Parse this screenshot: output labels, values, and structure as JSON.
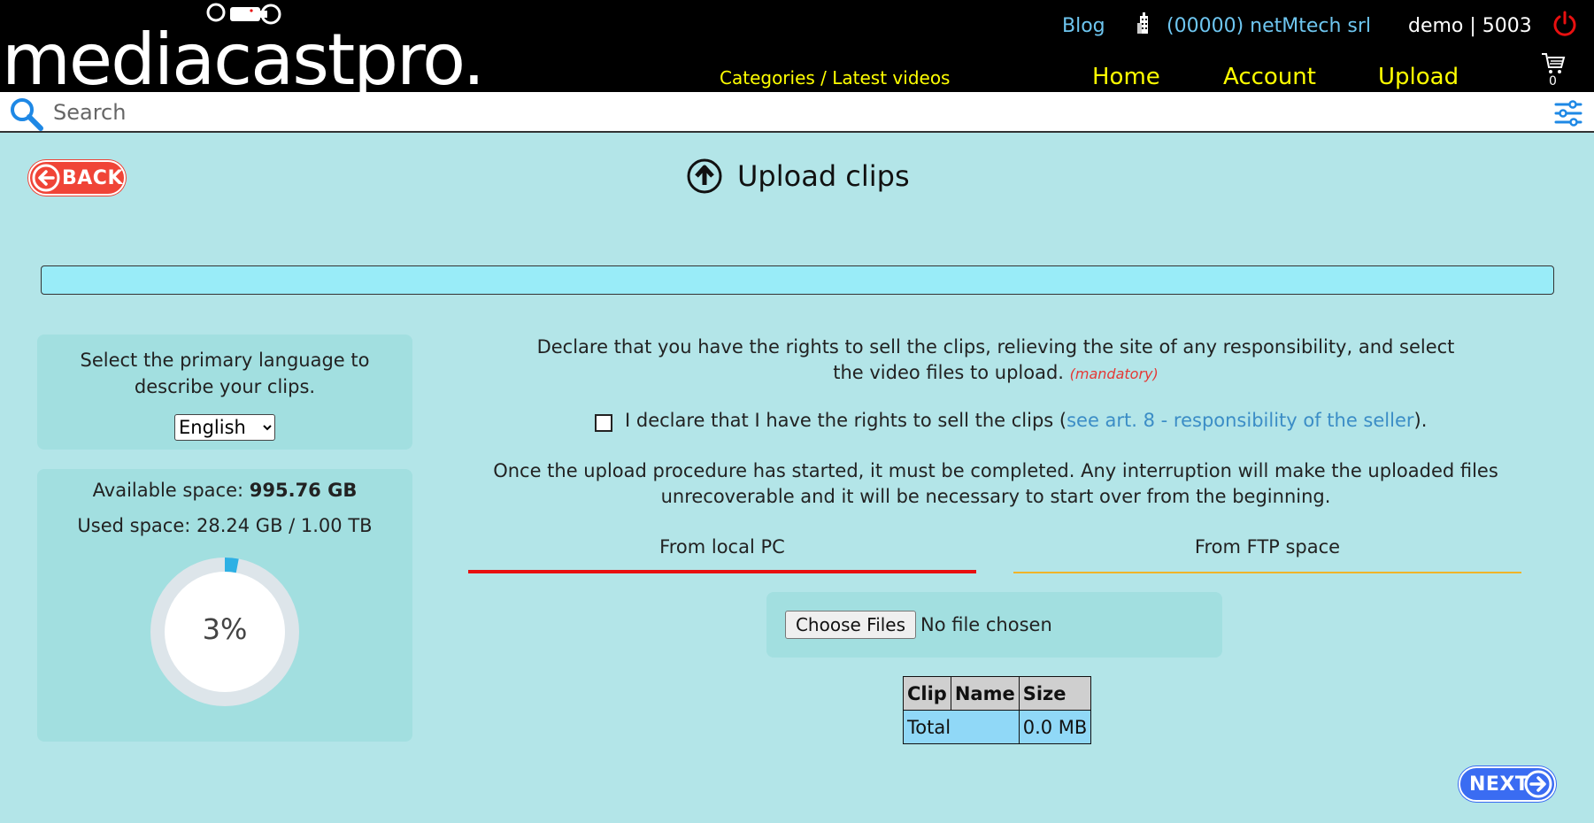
{
  "header": {
    "logo_text": "mediacastpro.",
    "blog_label": "Blog",
    "company_label": "(00000) netMtech srl",
    "user_info": "demo | 5003",
    "categories_label": "Categories / Latest videos",
    "nav": {
      "home": "Home",
      "account": "Account",
      "upload": "Upload"
    },
    "cart_count": "0",
    "colors": {
      "nav": "#ffff00",
      "link": "#6ec6f0",
      "power": "#e81010"
    }
  },
  "search": {
    "placeholder": "Search"
  },
  "page": {
    "back_label": "BACK",
    "title": "Upload clips",
    "next_label": "NEXT"
  },
  "language_panel": {
    "prompt": "Select the primary language to describe your clips.",
    "selected": "English"
  },
  "space_panel": {
    "available_label": "Available space: ",
    "available_value": "995.76 GB",
    "used_line": "Used space: 28.24 GB / 1.00 TB",
    "percent_label": "3%",
    "percent_value": 0.03
  },
  "declaration": {
    "text": "Declare that you have the rights to sell the clips, relieving the site of any responsibility, and select the video files to upload.",
    "mandatory": "(mandatory)",
    "checkbox_prefix": "I declare that I have the rights to sell the clips (",
    "checkbox_link": "see art. 8 - responsibility of the seller",
    "checkbox_suffix": ").",
    "warning": "Once the upload procedure has started, it must be completed. Any interruption will make the uploaded files unrecoverable and it will be necessary to start over from the beginning."
  },
  "tabs": {
    "local": "From local PC",
    "ftp": "From FTP space"
  },
  "file_input": {
    "button_label": "Choose Files",
    "status": "No file chosen"
  },
  "table": {
    "headers": [
      "Clip",
      "Name",
      "Size"
    ],
    "total_label": "Total",
    "total_size": "0.0 MB"
  }
}
